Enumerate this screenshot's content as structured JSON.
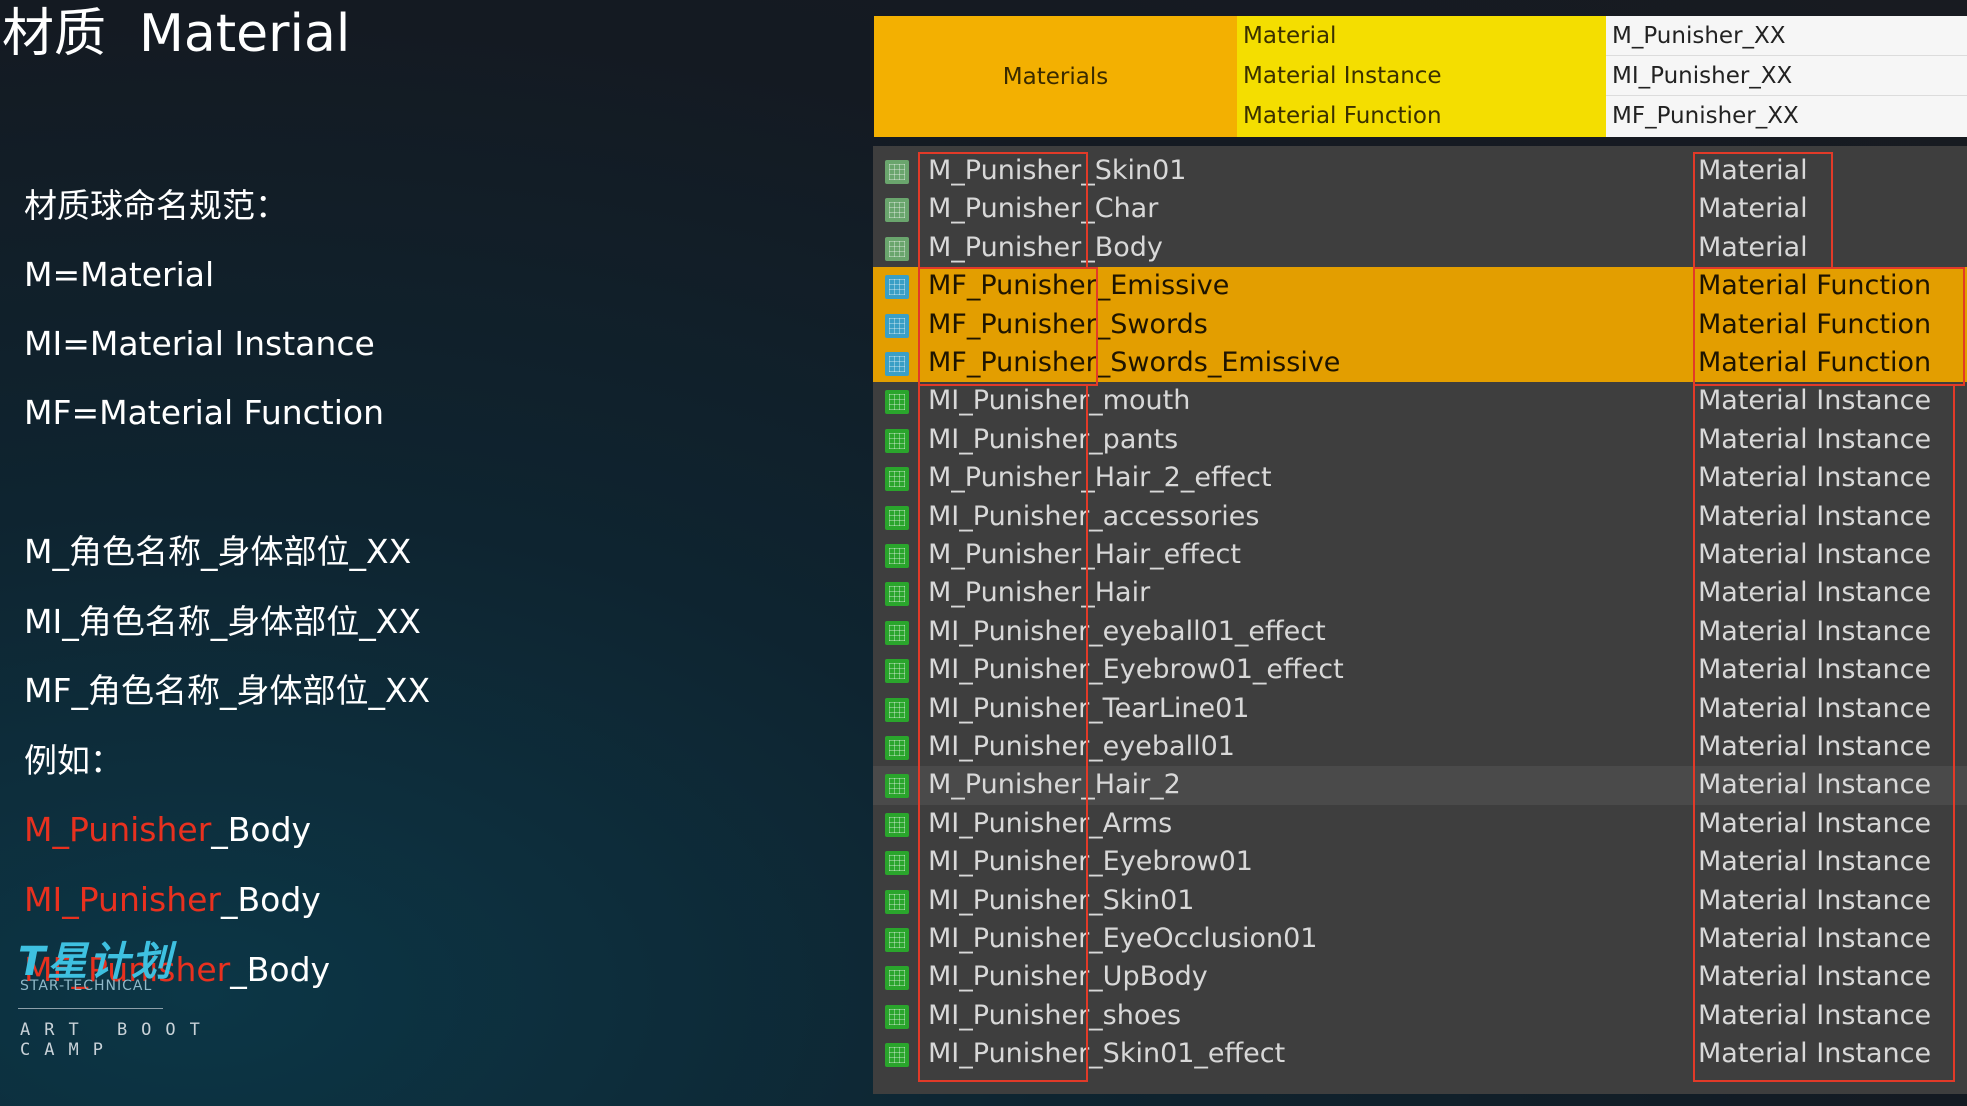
{
  "slide": {
    "title": "材质  Material",
    "rules": [
      "材质球命名规范：",
      "M=Material",
      "MI=Material Instance",
      "MF=Material Function",
      "M_角色名称_身体部位_XX",
      "MI_角色名称_身体部位_XX",
      "MF_角色名称_身体部位_XX",
      "例如："
    ],
    "examples": [
      {
        "prefix": "M_Punisher",
        "suffix": "_Body"
      },
      {
        "prefix": "MI_Punisher",
        "suffix": "_Body"
      },
      {
        "prefix": "MF_Punisher",
        "suffix": "_Body"
      }
    ],
    "accent_color": "#e8311f"
  },
  "logo": {
    "mark": "T星计划",
    "subtitle": "STAR-TECHNICAL",
    "tagline": "ART BOOT CAMP"
  },
  "legend": {
    "category": "Materials",
    "rows": [
      {
        "type": "Material",
        "prefix": "M_Punisher_XX"
      },
      {
        "type": "Material Instance",
        "prefix": "MI_Punisher_XX"
      },
      {
        "type": "Material Function",
        "prefix": "MF_Punisher_XX"
      }
    ],
    "colors": {
      "category": "#f3b001",
      "type": "#f4de00",
      "prefix": "#f6f6f6"
    }
  },
  "asset_list": {
    "rows": [
      {
        "name": "M_Punisher_Skin01",
        "type": "Material",
        "kind": "mat"
      },
      {
        "name": "M_Punisher_Char",
        "type": "Material",
        "kind": "mat"
      },
      {
        "name": "M_Punisher_Body",
        "type": "Material",
        "kind": "mat"
      },
      {
        "name": "MF_Punisher_Emissive",
        "type": "Material Function",
        "kind": "fn"
      },
      {
        "name": "MF_Punisher_Swords",
        "type": "Material Function",
        "kind": "fn"
      },
      {
        "name": "MF_Punisher_Swords_Emissive",
        "type": "Material Function",
        "kind": "fn"
      },
      {
        "name": "MI_Punisher_mouth",
        "type": "Material Instance",
        "kind": "inst"
      },
      {
        "name": "MI_Punisher_pants",
        "type": "Material Instance",
        "kind": "inst"
      },
      {
        "name": "M_Punisher_Hair_2_effect",
        "type": "Material Instance",
        "kind": "inst"
      },
      {
        "name": "MI_Punisher_accessories",
        "type": "Material Instance",
        "kind": "inst"
      },
      {
        "name": "M_Punisher_Hair_effect",
        "type": "Material Instance",
        "kind": "inst"
      },
      {
        "name": "M_Punisher_Hair",
        "type": "Material Instance",
        "kind": "inst"
      },
      {
        "name": "MI_Punisher_eyeball01_effect",
        "type": "Material Instance",
        "kind": "inst"
      },
      {
        "name": "MI_Punisher_Eyebrow01_effect",
        "type": "Material Instance",
        "kind": "inst"
      },
      {
        "name": "MI_Punisher_TearLine01",
        "type": "Material Instance",
        "kind": "inst"
      },
      {
        "name": "MI_Punisher_eyeball01",
        "type": "Material Instance",
        "kind": "inst"
      },
      {
        "name": "M_Punisher_Hair_2",
        "type": "Material Instance",
        "kind": "inst"
      },
      {
        "name": "MI_Punisher_Arms",
        "type": "Material Instance",
        "kind": "inst"
      },
      {
        "name": "MI_Punisher_Eyebrow01",
        "type": "Material Instance",
        "kind": "inst"
      },
      {
        "name": "MI_Punisher_Skin01",
        "type": "Material Instance",
        "kind": "inst"
      },
      {
        "name": "MI_Punisher_EyeOcclusion01",
        "type": "Material Instance",
        "kind": "inst"
      },
      {
        "name": "MI_Punisher_UpBody",
        "type": "Material Instance",
        "kind": "inst"
      },
      {
        "name": "MI_Punisher_shoes",
        "type": "Material Instance",
        "kind": "inst"
      },
      {
        "name": "MI_Punisher_Skin01_effect",
        "type": "Material Instance",
        "kind": "inst"
      }
    ],
    "hovered_row": "M_Punisher_Hair_2",
    "colors": {
      "background": "#3e3e3e",
      "function_row": "#e39e00",
      "highlight_box": "#e23a28"
    }
  }
}
